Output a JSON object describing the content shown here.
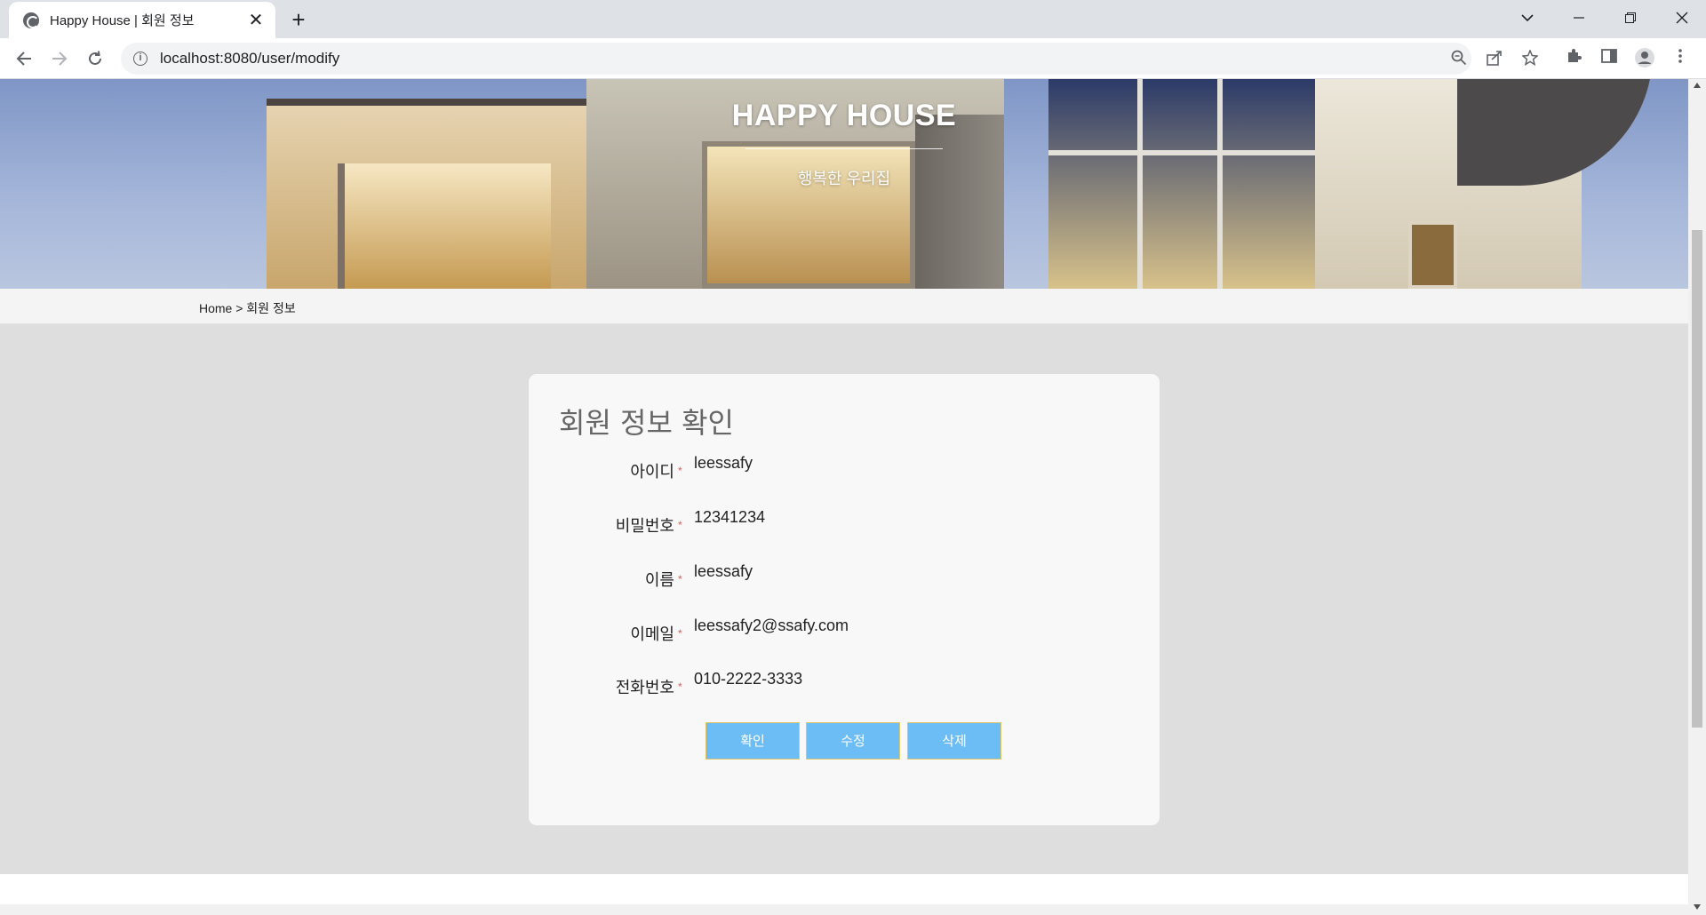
{
  "browser": {
    "tab_title": "Happy House | 회원 정보",
    "tab_close": "✕",
    "new_tab": "+",
    "url": "localhost:8080/user/modify",
    "info_glyph": "i"
  },
  "hero": {
    "title": "HAPPY HOUSE",
    "subtitle": "행복한 우리집"
  },
  "breadcrumb": {
    "text": "Home > 회원 정보"
  },
  "card": {
    "title": "회원 정보 확인",
    "required_mark": "*",
    "fields": [
      {
        "label": "아이디",
        "value": "leessafy"
      },
      {
        "label": "비밀번호",
        "value": "12341234"
      },
      {
        "label": "이름",
        "value": "leessafy"
      },
      {
        "label": "이메일",
        "value": "leessafy2@ssafy.com"
      },
      {
        "label": "전화번호",
        "value": "010-2222-3333"
      }
    ],
    "buttons": {
      "confirm": "확인",
      "modify": "수정",
      "delete": "삭제"
    }
  },
  "colors": {
    "button_bg": "#6cbcf5",
    "button_border": "#e0c56a",
    "required": "#e05a5a",
    "page_bg": "#dedede",
    "card_bg": "#f8f8f8"
  }
}
